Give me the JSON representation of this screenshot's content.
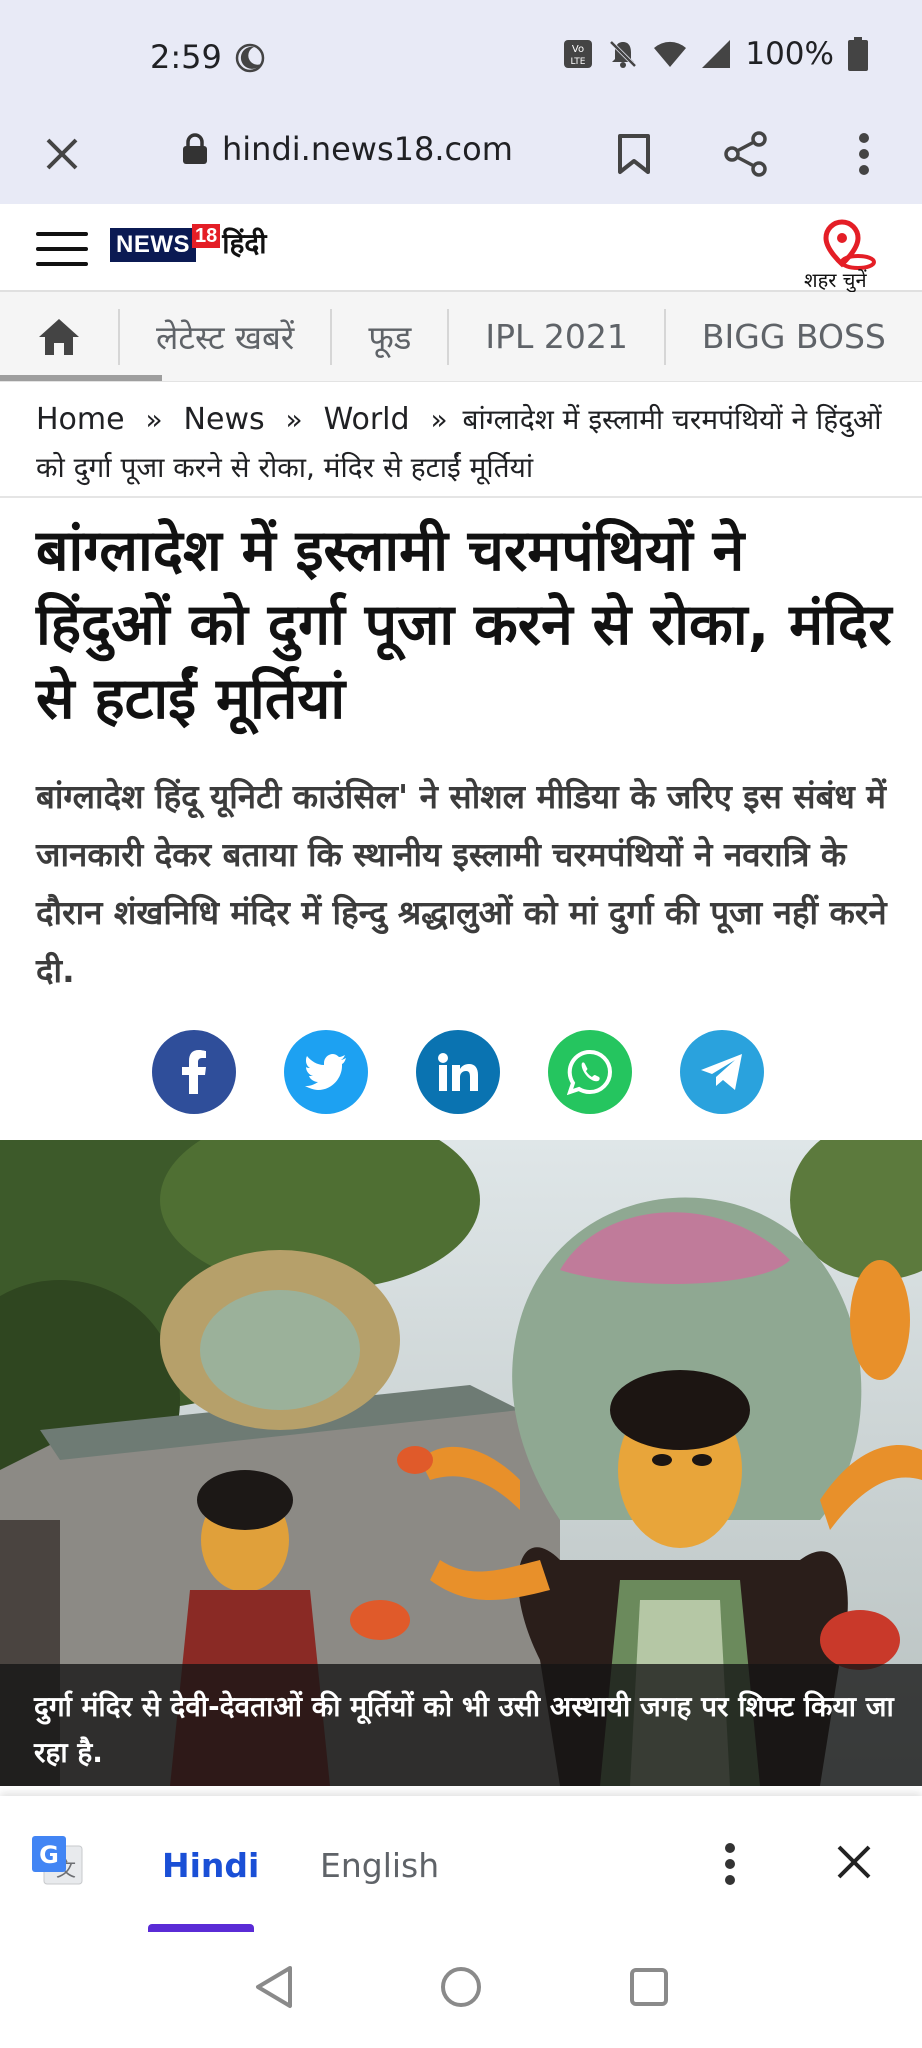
{
  "status_bar": {
    "time": "2:59",
    "battery": "100%"
  },
  "toolbar": {
    "url": "hindi.news18.com"
  },
  "site": {
    "logo_news": "NEWS",
    "logo_18": "18",
    "logo_hindi": "हिंदी",
    "city_label": "शहर चुनें"
  },
  "nav_tabs": {
    "items": [
      "लेटेस्ट खबरें",
      "फूड",
      "IPL 2021",
      "BIGG BOSS"
    ]
  },
  "breadcrumb": {
    "home": "Home",
    "news": "News",
    "world": "World",
    "separator": "»",
    "current": "बांग्लादेश में इस्लामी चरमपंथियों ने हिंदुओं को दुर्गा पूजा करने से रोका, मंदिर से हटाईं मूर्तियां"
  },
  "article": {
    "headline": "बांग्लादेश में इस्लामी चरमपंथियों ने हिंदुओं को दुर्गा पूजा करने से रोका, मंदिर से हटाईं मूर्तियां",
    "summary": "बांग्लादेश हिंदू यूनिटी काउंसिल' ने सोशल मीडिया के जरिए इस संबंध में जानकारी देकर बताया कि स्थानीय इस्लामी चरमपंथियों ने नवरात्रि के दौरान शंखनिधि मंदिर में हिन्दु श्रद्धालुओं को मां दुर्गा की पूजा नहीं करने दी.",
    "image_caption": "दुर्गा मंदिर से देवी-देवताओं की मूर्तियों को भी उसी अस्थायी जगह पर शिफ्ट किया जा रहा है."
  },
  "share": {
    "icons": [
      "facebook-icon",
      "twitter-icon",
      "linkedin-icon",
      "whatsapp-icon",
      "telegram-icon"
    ]
  },
  "translate_bar": {
    "lang_selected": "Hindi",
    "lang_other": "English"
  },
  "colors": {
    "browser_chrome": "#e8eaf6",
    "brand_navy": "#0b1a53",
    "brand_red": "#e41e26",
    "translate_accent": "#5a2bd6",
    "link_blue": "#1a4fd6"
  }
}
